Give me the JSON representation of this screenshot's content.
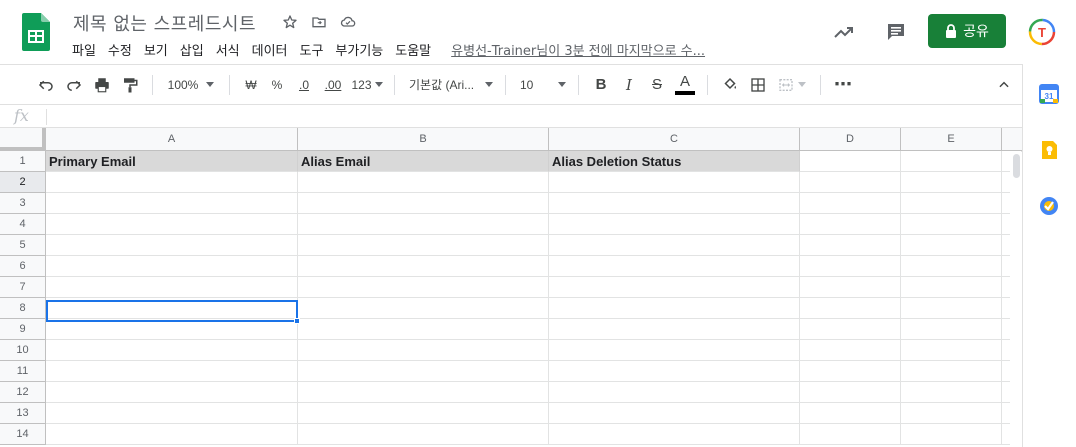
{
  "header": {
    "title": "제목 없는 스프레드시트",
    "menu": [
      "파일",
      "수정",
      "보기",
      "삽입",
      "서식",
      "데이터",
      "도구",
      "부가기능",
      "도움말"
    ],
    "last_edit": "유병선-Trainer님이 3분 전에 마지막으로 수...",
    "share_label": "공유",
    "avatar_letter": "T"
  },
  "toolbar": {
    "zoom": "100%",
    "currency": "₩",
    "percent": "%",
    "decimal_decrease": ".0",
    "decimal_increase": ".00",
    "more_formats": "123",
    "font": "기본값 (Ari...",
    "font_size": "10",
    "bold": "B",
    "italic": "I",
    "strike": "S",
    "text_color": "A",
    "more": "⋯"
  },
  "formula_bar": {
    "fx_label": "fx",
    "value": ""
  },
  "grid": {
    "columns": [
      "A",
      "B",
      "C",
      "D",
      "E"
    ],
    "rows": [
      "1",
      "2",
      "3",
      "4",
      "5",
      "6",
      "7",
      "8",
      "9",
      "10",
      "11",
      "12",
      "13",
      "14"
    ],
    "header_row": [
      "Primary Email",
      "Alias Email",
      "Alias Deletion Status"
    ],
    "selected_cell": "A2"
  },
  "colors": {
    "accent": "#1a73e8",
    "share_green": "#188038",
    "header_fill": "#d9d9d9"
  }
}
